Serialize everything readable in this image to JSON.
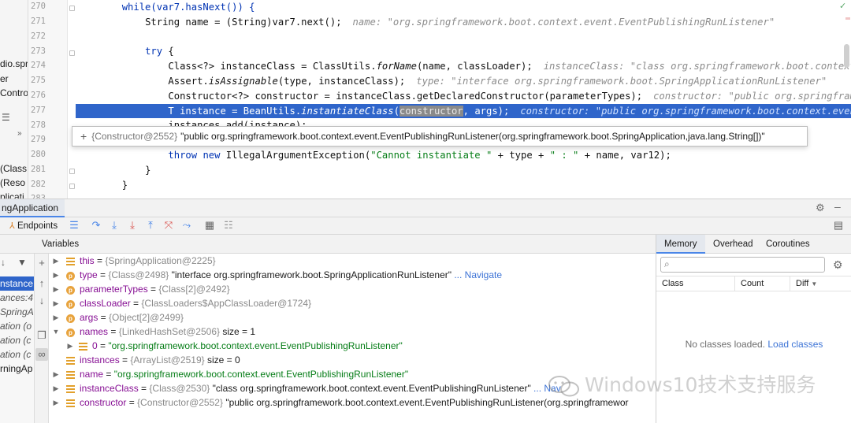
{
  "left_strip": {
    "items": [
      "dio.spri",
      "er",
      "Contro",
      "(Class",
      "(Reso",
      "plicati"
    ]
  },
  "editor": {
    "lines": [
      {
        "n": "270"
      },
      {
        "n": "271"
      },
      {
        "n": "272"
      },
      {
        "n": "273"
      },
      {
        "n": "274"
      },
      {
        "n": "275"
      },
      {
        "n": "276"
      },
      {
        "n": "277"
      },
      {
        "n": "278"
      },
      {
        "n": "279"
      },
      {
        "n": "280"
      },
      {
        "n": "281"
      },
      {
        "n": "282"
      },
      {
        "n": "283"
      }
    ],
    "code": {
      "l270": "while(var7.hasNext()) {",
      "l271_a": "String name = (String)var7.next();",
      "l271_hint": "name: \"org.springframework.boot.context.event.EventPublishingRunListener\"",
      "l273_kw": "try",
      "l273_b": " {",
      "l274_a": "Class<?> instanceClass = ClassUtils.",
      "l274_it": "forName",
      "l274_b": "(name, classLoader);",
      "l274_hint": "instanceClass: \"class org.springframework.boot.context.ev",
      "l275_a": "Assert.",
      "l275_it": "isAssignable",
      "l275_b": "(type, instanceClass);",
      "l275_hint": "type: \"interface org.springframework.boot.SpringApplicationRunListener\"",
      "l276_a": "Constructor<?> constructor = instanceClass.getDeclaredConstructor(parameterTypes);",
      "l276_hint": "constructor: \"public org.springframewo",
      "l277_a": "T instance = BeanUtils.",
      "l277_it": "instantiateClass",
      "l277_b": "(",
      "l277_sel": "constructor",
      "l277_c": ", args);",
      "l277_hint": "constructor: \"public org.springframework.boot.context.event.E",
      "l278": "instances.add(instance);",
      "l280_kw1": "throw",
      "l280_kw2": "new",
      "l280_a": "IllegalArgumentException(",
      "l280_s1": "\"Cannot instantiate \"",
      "l280_b": " + type + ",
      "l280_s2": "\" : \"",
      "l280_c": " + name, var12);",
      "l281": "}",
      "l282": "}"
    },
    "tooltip": {
      "plus": "+",
      "obj": "{Constructor@2552}",
      "text": "\"public org.springframework.boot.context.event.EventPublishingRunListener(org.springframework.boot.SpringApplication,java.lang.String[])\""
    }
  },
  "debug": {
    "tab_label": "ngApplication",
    "endpoints_label": "Endpoints",
    "variables_title": "Variables",
    "frames": [
      "nstance",
      "ances:4",
      "SpringA",
      "ation (o",
      "ation (c",
      "ation (c",
      "rningAp"
    ],
    "variables": [
      {
        "name": "this",
        "ref": "{SpringApplication@2225}",
        "value": ""
      },
      {
        "name": "type",
        "ref": "{Class@2498}",
        "value": "\"interface org.springframework.boot.SpringApplicationRunListener\"",
        "link": "... Navigate"
      },
      {
        "name": "parameterTypes",
        "ref": "{Class[2]@2492}",
        "value": ""
      },
      {
        "name": "classLoader",
        "ref": "{ClassLoaders$AppClassLoader@1724}",
        "value": ""
      },
      {
        "name": "args",
        "ref": "{Object[2]@2499}",
        "value": ""
      },
      {
        "name": "names",
        "ref": "{LinkedHashSet@2506}",
        "value": " size = 1"
      },
      {
        "name": "0",
        "ref": "",
        "value": "\"org.springframework.boot.context.event.EventPublishingRunListener\""
      },
      {
        "name": "instances",
        "ref": "{ArrayList@2519}",
        "value": " size = 0"
      },
      {
        "name": "name",
        "ref": "",
        "value": "\"org.springframework.boot.context.event.EventPublishingRunListener\""
      },
      {
        "name": "instanceClass",
        "ref": "{Class@2530}",
        "value": "\"class org.springframework.boot.context.event.EventPublishingRunListener\"",
        "link": "... Nav"
      },
      {
        "name": "constructor",
        "ref": "{Constructor@2552}",
        "value": "\"public org.springframework.boot.context.event.EventPublishingRunListener(org.springframewor"
      }
    ]
  },
  "memory": {
    "tabs": [
      "Memory",
      "Overhead",
      "Coroutines"
    ],
    "search_placeholder": "",
    "columns": [
      "Class",
      "Count",
      "Diff"
    ],
    "empty_text": "No classes loaded.",
    "load_link": "Load classes"
  },
  "watermark": {
    "text": "Windows10技术支持服务"
  }
}
